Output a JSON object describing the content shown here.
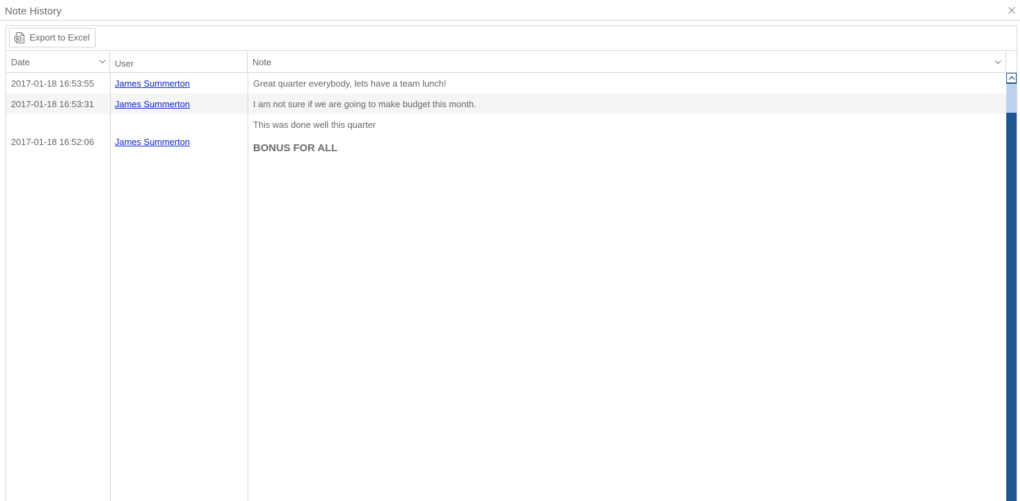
{
  "window": {
    "title": "Note History",
    "close_icon": "close-icon"
  },
  "toolbar": {
    "export_label": "Export to Excel",
    "export_icon": "excel-icon"
  },
  "table": {
    "columns": [
      {
        "label": "Date",
        "sortable_indicator": "chevron-down-icon"
      },
      {
        "label": "User"
      },
      {
        "label": "Note",
        "sortable_indicator": "chevron-down-icon"
      }
    ],
    "rows": [
      {
        "date": "2017-01-18 16:53:55",
        "user": "James Summerton",
        "note": "Great quarter everybody, lets have a team lunch!"
      },
      {
        "date": "2017-01-18 16:53:31",
        "user": "James Summerton",
        "note": "I am not sure if we are going to make budget this month."
      },
      {
        "date": "2017-01-18 16:52:06",
        "user": "James Summerton",
        "note": "This was done well this quarter",
        "note_emphasis": "BONUS FOR ALL"
      }
    ]
  },
  "colors": {
    "link": "#0b24c9",
    "scrollbar_track": "#1e5692",
    "scrollbar_thumb": "#bcd3ee",
    "alt_row": "#f5f5f5",
    "border": "#d6d6d6"
  }
}
